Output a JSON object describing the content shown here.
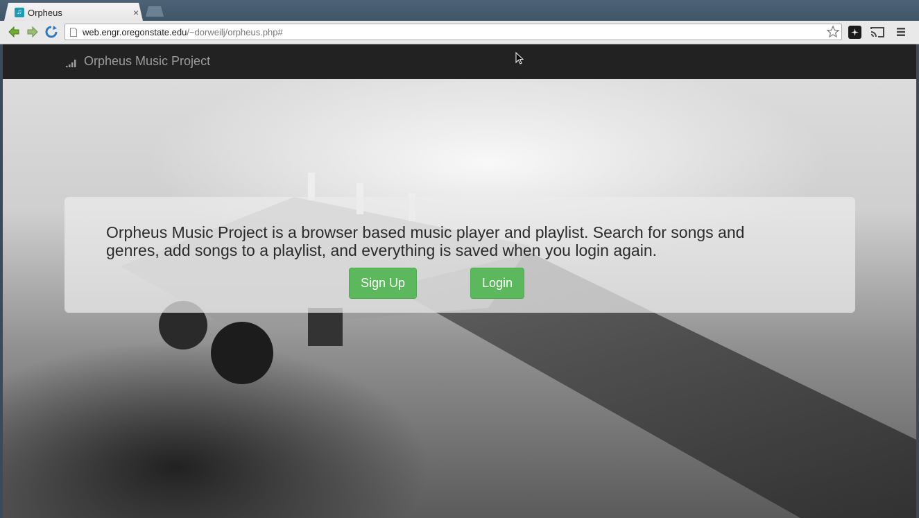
{
  "browser": {
    "tab": {
      "title": "Orpheus",
      "favicon": "music-note-icon",
      "close": "×"
    },
    "address": {
      "host": "web.engr.oregonstate.edu",
      "path": "/~dorweilj/orpheus.php#"
    }
  },
  "navbar": {
    "brand": "Orpheus Music Project",
    "brand_icon": "signal-bars-icon"
  },
  "jumbotron": {
    "lead": "Orpheus Music Project is a browser based music player and playlist. Search for songs and genres, add songs to a playlist, and everything is saved when you login again.",
    "signup_label": "Sign Up",
    "login_label": "Login"
  },
  "colors": {
    "navbar": "#222222",
    "button": "#5cb85c",
    "brand_text": "#9d9d9d"
  }
}
